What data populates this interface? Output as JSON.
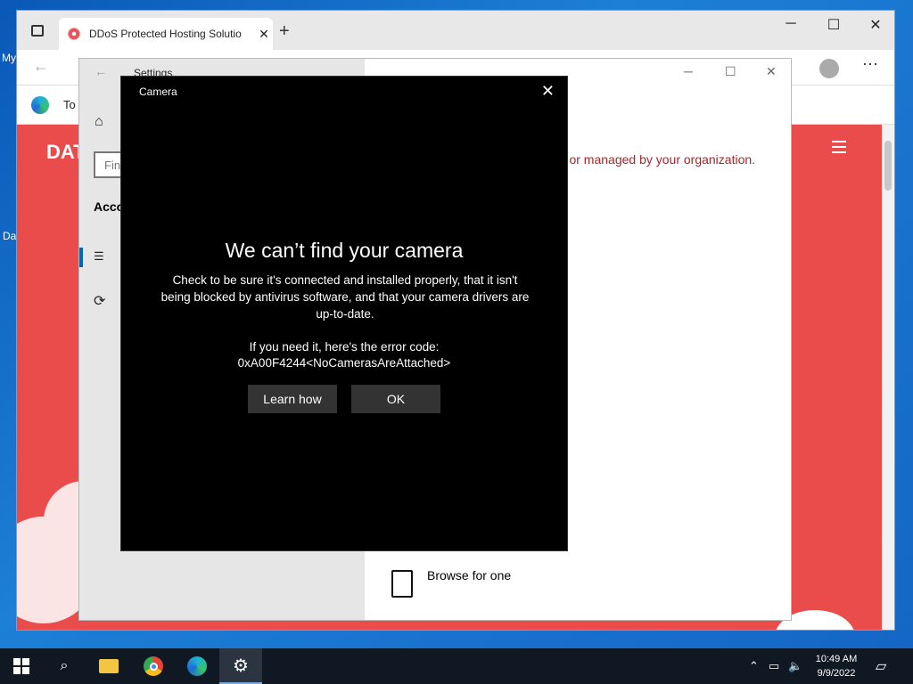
{
  "desktop": {
    "label_1": "My",
    "label_2": "Da"
  },
  "browser": {
    "tab_title": "DDoS Protected Hosting Solutio",
    "tab_close": "✕",
    "new_tab": "+",
    "fav_text": "To",
    "page_brand": "DAT"
  },
  "settings": {
    "title": "Settings",
    "search_placeholder": "Fin",
    "section": "Acco",
    "org_message": "en or managed by your organization.",
    "browse_label": "Browse for one"
  },
  "camera": {
    "title": "Camera",
    "heading": "We can’t find your camera",
    "body": "Check to be sure it's connected and installed properly, that it isn't being blocked by antivirus software, and that your camera drivers are up-to-date.",
    "code_intro": "If you need it, here's the error code:",
    "code": "0xA00F4244<NoCamerasAreAttached>",
    "learn_button": "Learn how",
    "ok_button": "OK"
  },
  "taskbar": {
    "time": "10:49 AM",
    "date": "9/9/2022"
  }
}
